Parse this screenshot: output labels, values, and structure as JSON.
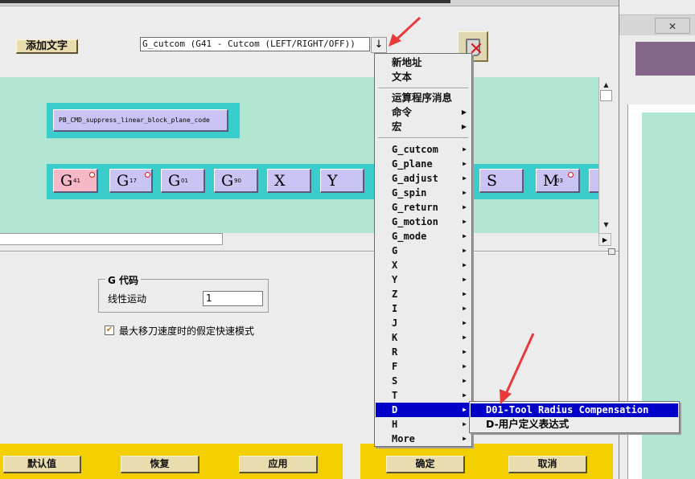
{
  "toolbar": {
    "add_text_label": "添加文字",
    "combo_value": "G_cutcom (G41 - Cutcom (LEFT/RIGHT/OFF))",
    "combo_arrow": "↓"
  },
  "canvas": {
    "block_label": "PB_CMD_suppress_linear_block_plane_code",
    "words": [
      {
        "letter": "G",
        "sub": "41",
        "dot": true
      },
      {
        "letter": "G",
        "sub": "17",
        "dot": true
      },
      {
        "letter": "G",
        "sub": "01",
        "dot": false
      },
      {
        "letter": "G",
        "sub": "90",
        "dot": false
      },
      {
        "letter": "X",
        "sub": "",
        "dot": false
      },
      {
        "letter": "Y",
        "sub": "",
        "dot": false
      },
      {
        "letter": "S",
        "sub": "",
        "dot": false
      },
      {
        "letter": "M",
        "sub": "03",
        "dot": true
      }
    ]
  },
  "gcode": {
    "legend": "G 代码",
    "linear_label": "线性运动",
    "linear_value": "1"
  },
  "checkbox": {
    "label": "最大移刀速度时的假定快速模式",
    "checked": true
  },
  "buttons": {
    "default": "默认值",
    "restore": "恢复",
    "apply": "应用",
    "ok": "确定",
    "cancel": "取消"
  },
  "menu": {
    "items": [
      {
        "label": "新地址",
        "arrow": false
      },
      {
        "label": "文本",
        "arrow": false
      },
      {
        "label": "运算程序消息",
        "arrow": false
      },
      {
        "label": "命令",
        "arrow": true
      },
      {
        "label": "宏",
        "arrow": true
      },
      {
        "label": "G_cutcom",
        "arrow": true
      },
      {
        "label": "G_plane",
        "arrow": true
      },
      {
        "label": "G_adjust",
        "arrow": true
      },
      {
        "label": "G_spin",
        "arrow": true
      },
      {
        "label": "G_return",
        "arrow": true
      },
      {
        "label": "G_motion",
        "arrow": true
      },
      {
        "label": "G_mode",
        "arrow": true
      },
      {
        "label": "G",
        "arrow": true
      },
      {
        "label": "X",
        "arrow": true
      },
      {
        "label": "Y",
        "arrow": true
      },
      {
        "label": "Z",
        "arrow": true
      },
      {
        "label": "I",
        "arrow": true
      },
      {
        "label": "J",
        "arrow": true
      },
      {
        "label": "K",
        "arrow": true
      },
      {
        "label": "R",
        "arrow": true
      },
      {
        "label": "F",
        "arrow": true
      },
      {
        "label": "S",
        "arrow": true
      },
      {
        "label": "T",
        "arrow": true
      },
      {
        "label": "D",
        "arrow": true
      },
      {
        "label": "H",
        "arrow": true
      },
      {
        "label": "More",
        "arrow": true
      }
    ],
    "selected": "D"
  },
  "submenu": {
    "items": [
      {
        "label": "D01-Tool Radius Compensation"
      },
      {
        "label": "D-用户定义表达式"
      }
    ],
    "selected": "D01-Tool Radius Compensation"
  },
  "bg_window": {
    "close_glyph": "✕"
  },
  "colors": {
    "canvas": "#b1e6d2",
    "block_bg": "#39cdcd",
    "word_bg": "#c9c4f3",
    "active_word": "#f6b8c7",
    "menu_highlight": "#0000c8",
    "action_bar": "#f4cf00",
    "annotation": "#e83a3a"
  },
  "icons": {
    "trash": "trash-icon",
    "combo_arrow": "download-arrow-icon",
    "submenu_arrow": "triangle-right-icon"
  }
}
